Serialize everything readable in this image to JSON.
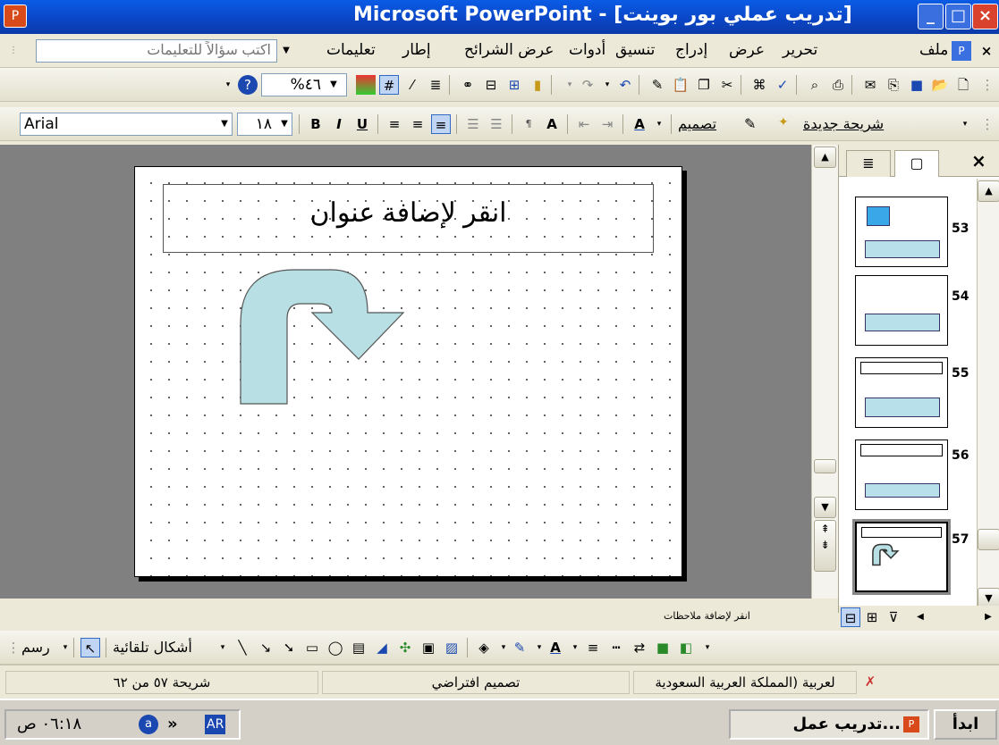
{
  "window": {
    "title": "Microsoft PowerPoint - [تدريب عملي بور بوينت]",
    "close_label": "×",
    "maximize_label": "□",
    "minimize_label": "_"
  },
  "menubar": {
    "items": [
      "ملف",
      "تحرير",
      "عرض",
      "إدراج",
      "تنسيق",
      "أدوات",
      "عرض الشرائح",
      "إطار",
      "تعليمات"
    ],
    "help_placeholder": "اكتب سؤالاً للتعليمات",
    "doc_close": "×"
  },
  "standard_toolbar": {
    "zoom_value": "%٤٦"
  },
  "formatting_toolbar": {
    "font_name": "Arial",
    "font_size": "١٨",
    "bold": "B",
    "italic": "I",
    "underline": "U",
    "font_color": "A",
    "design_label": "تصميم",
    "new_slide_label": "شريحة جديدة"
  },
  "slide": {
    "title_placeholder": "انقر لإضافة عنوان"
  },
  "slides_pane": {
    "thumbnails": [
      {
        "number": "53"
      },
      {
        "number": "54"
      },
      {
        "number": "55"
      },
      {
        "number": "56"
      },
      {
        "number": "57"
      }
    ],
    "close_label": "×"
  },
  "notes": {
    "placeholder": "انقر لإضافة ملاحظات"
  },
  "drawing_toolbar": {
    "draw_label": "رسم",
    "autoshapes_label": "أشكال تلقائية"
  },
  "statusbar": {
    "slide_position": "شريحة ٥٧ من ٦٢",
    "design": "تصميم افتراضي",
    "language": "لعربية (المملكة العربية السعودية"
  },
  "taskbar": {
    "start_label": "ابدأ",
    "task_label": "تدريب عمل...",
    "clock": "٠٦:١٨ ص",
    "input_lang": "AR"
  },
  "colors": {
    "titlebar": "#0a5ce6",
    "arrow_fill": "#b8e0e4",
    "workspace": "#808080"
  }
}
